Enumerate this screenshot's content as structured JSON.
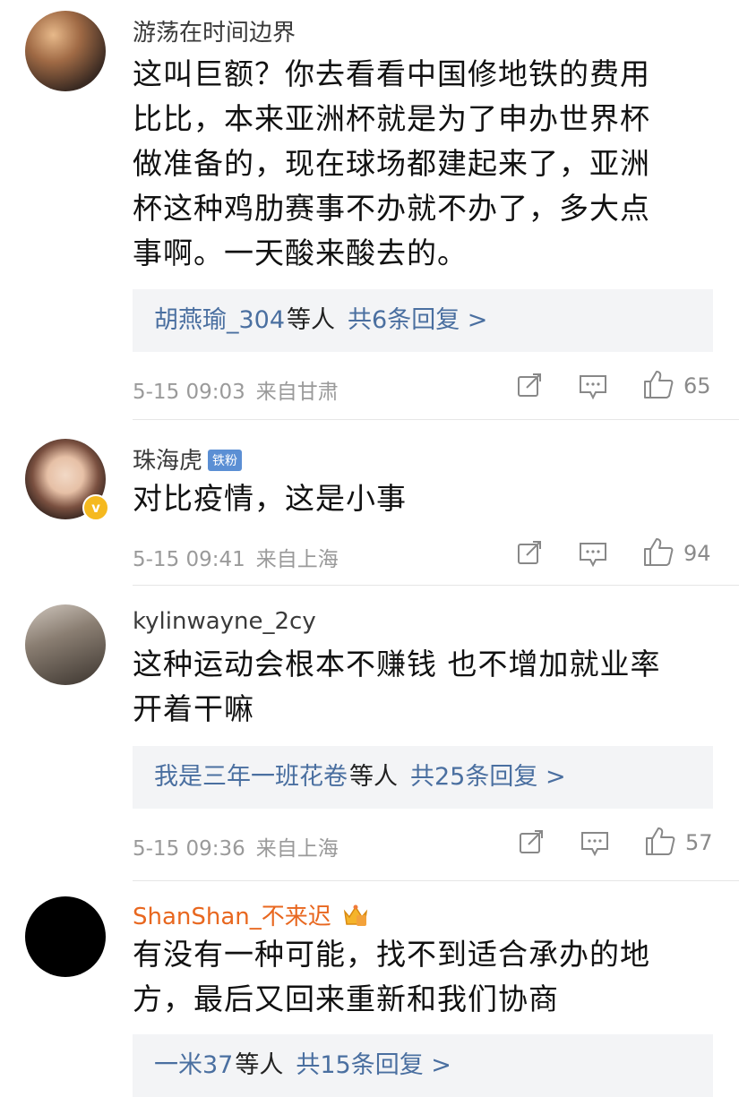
{
  "comments": [
    {
      "username": "游荡在时间边界",
      "text_lines": [
        "这叫巨额？你去看看中国修地铁的费用",
        "比比，本来亚洲杯就是为了申办世界杯",
        "做准备的，现在球场都建起来了，亚洲",
        "杯这种鸡肋赛事不办就不办了，多大点",
        "事啊。一天酸来酸去的。"
      ],
      "replies_names": "胡燕瑜_304",
      "replies_mid": "等人",
      "replies_count": "共6条回复 >",
      "time": "5-15 09:03",
      "location": "来自甘肃",
      "likes": "65"
    },
    {
      "username": "珠海虎",
      "badge": "铁粉",
      "verified": "v",
      "text_lines": [
        "对比疫情，这是小事"
      ],
      "time": "5-15 09:41",
      "location": "来自上海",
      "likes": "94"
    },
    {
      "username": "kylinwayne_2cy",
      "text_lines": [
        "这种运动会根本不赚钱 也不增加就业率",
        "开着干嘛"
      ],
      "replies_names": "我是三年一班花卷",
      "replies_mid": "等人",
      "replies_count": "共25条回复 >",
      "time": "5-15 09:36",
      "location": "来自上海",
      "likes": "57"
    },
    {
      "username": "ShanShan_不来迟",
      "text_lines": [
        "有没有一种可能，找不到适合承办的地",
        "方，最后又回来重新和我们协商"
      ],
      "replies_names": "一米37",
      "replies_mid": "等人",
      "replies_count": "共15条回复 >"
    }
  ],
  "colors": {
    "link": "#4a6fa0",
    "vip_name": "#e8671f",
    "badge": "#5b8fd4",
    "verified": "#f5b91f"
  },
  "icons": {
    "share": "share-icon",
    "comment": "comment-icon",
    "like": "thumbs-up-icon",
    "crown": "crown-icon"
  }
}
